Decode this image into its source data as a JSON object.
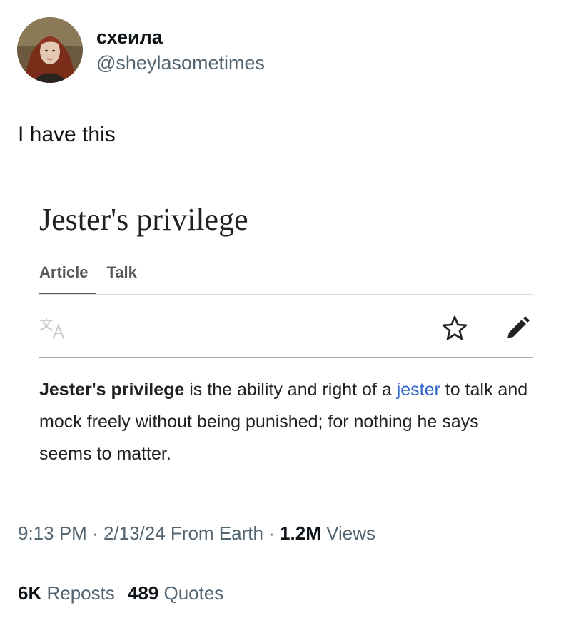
{
  "author": {
    "display_name": "схеила",
    "handle": "@sheylasometimes"
  },
  "tweet": {
    "text": "I have this"
  },
  "wiki": {
    "title": "Jester's privilege",
    "tabs": [
      "Article",
      "Talk"
    ],
    "body_bold": "Jester's privilege",
    "body_mid": " is the ability and right of a ",
    "body_link": "jester",
    "body_end": " to talk and mock freely without being punished; for nothing he says seems to matter."
  },
  "meta": {
    "time": "9:13 PM",
    "sep1": " · ",
    "date": "2/13/24",
    "source": " From Earth",
    "sep2": " · ",
    "views_count": "1.2M",
    "views_label": " Views"
  },
  "stats": {
    "reposts_count": "6K",
    "reposts_label": " Reposts",
    "quotes_count": "489",
    "quotes_label": " Quotes"
  },
  "icons": [
    "avatar",
    "translate-icon",
    "star-icon",
    "edit-icon"
  ],
  "colors": {
    "link": "#3366cc",
    "muted": "#536471"
  }
}
